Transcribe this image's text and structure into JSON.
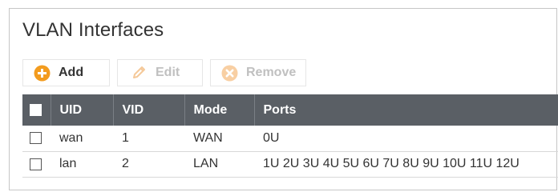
{
  "title": "VLAN Interfaces",
  "toolbar": {
    "add_label": "Add",
    "edit_label": "Edit",
    "remove_label": "Remove"
  },
  "table": {
    "columns": [
      "UID",
      "VID",
      "Mode",
      "Ports"
    ],
    "rows": [
      {
        "uid": "wan",
        "vid": "1",
        "mode": "WAN",
        "ports": "0U"
      },
      {
        "uid": "lan",
        "vid": "2",
        "mode": "LAN",
        "ports": "1U 2U 3U 4U 5U 6U 7U 8U 9U 10U 11U 12U"
      }
    ]
  },
  "colors": {
    "accent_orange": "#f39c1f",
    "header_bg": "#5a5f65",
    "disabled_text": "#c0c0c0",
    "text": "#333333"
  },
  "icons": {
    "add": "plus-circle-icon",
    "edit": "pencil-icon",
    "remove": "x-circle-icon"
  }
}
